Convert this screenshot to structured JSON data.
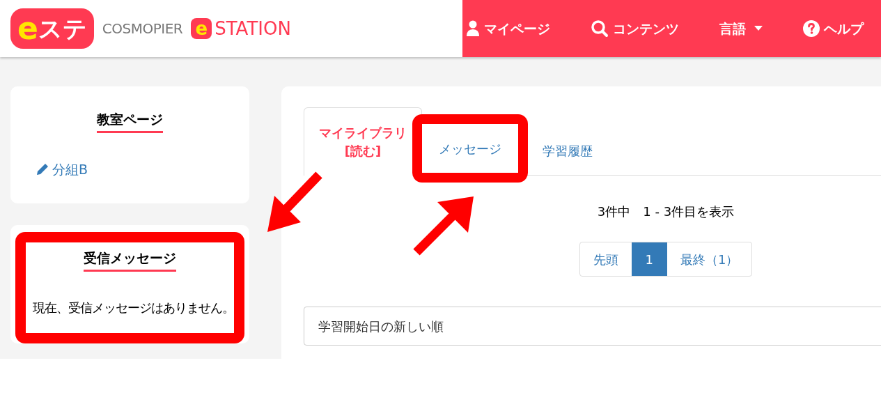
{
  "header": {
    "logo": {
      "badge_letter": "e",
      "badge_text": "ステ",
      "brand": "COSMOPIER",
      "station_letter": "e",
      "station_text": "STATION"
    },
    "nav": [
      {
        "kind": "user",
        "label": "マイページ"
      },
      {
        "kind": "search",
        "label": "コンテンツ"
      },
      {
        "kind": "dropdown",
        "label": "言語"
      },
      {
        "kind": "help",
        "label": "ヘルプ"
      }
    ]
  },
  "sidebar": {
    "classroom": {
      "title": "教室ページ",
      "link": "分組B"
    },
    "messages": {
      "title": "受信メッセージ",
      "text": "現在、受信メッセージはありません。",
      "highlighted": true
    }
  },
  "main": {
    "tabs": [
      {
        "lines": [
          "マイライブラリ",
          "[読む]"
        ],
        "selected": true,
        "highlighted": false
      },
      {
        "lines": [
          "メッセージ"
        ],
        "selected": false,
        "highlighted": true
      },
      {
        "lines": [
          "学習履歴"
        ],
        "selected": false,
        "highlighted": false
      }
    ],
    "summary": "3件中　1 - 3件目を表示",
    "pagination": [
      {
        "label": "先頭",
        "selected": false
      },
      {
        "label": "1",
        "selected": true
      },
      {
        "label": "最終（1）",
        "selected": false
      }
    ],
    "sort": {
      "value": "学習開始日の新しい順"
    }
  }
}
